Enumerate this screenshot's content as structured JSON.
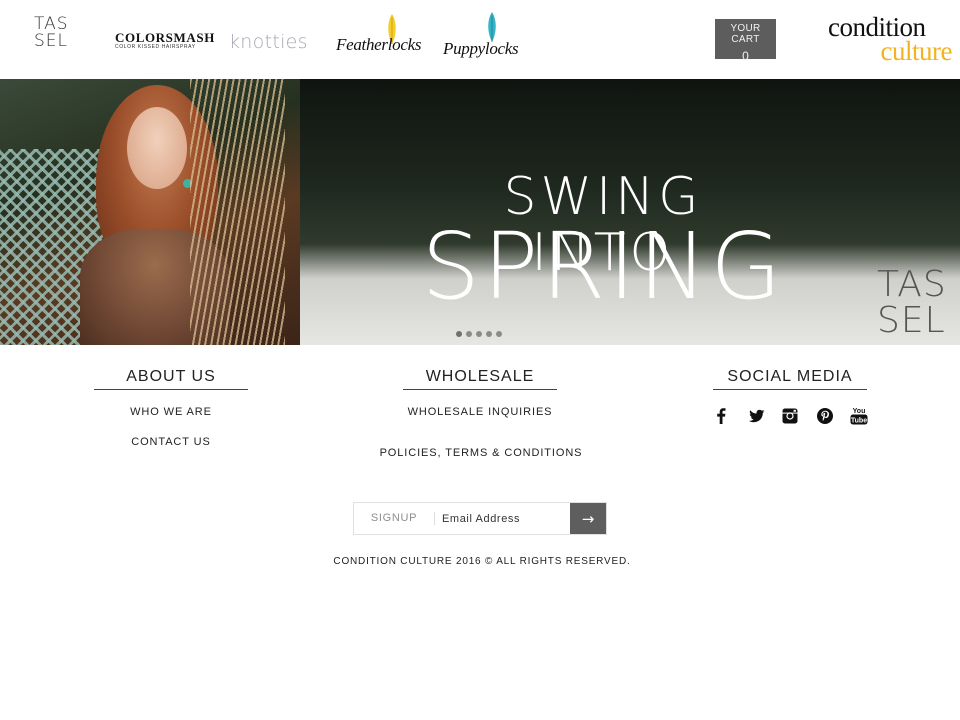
{
  "header": {
    "brands": {
      "tassel": [
        "TAS",
        "SEL"
      ],
      "colorsmash": {
        "name": "COLORSMASH",
        "tagline": "COLOR KISSED HAIRSPRAY"
      },
      "knotties": "knotties",
      "featherlocks": "Featherlocks",
      "puppylocks": "Puppylocks",
      "condition_culture": {
        "line1": "condition",
        "line2": "culture"
      }
    },
    "cart": {
      "label": "YOUR CART",
      "count": "0"
    }
  },
  "hero": {
    "headline_1": "SWING INTO",
    "headline_2": "SPRING",
    "corner_logo": [
      "TAS",
      "SEL"
    ],
    "slide_count": 5,
    "active_slide": 1
  },
  "footer": {
    "about": {
      "title": "ABOUT US",
      "links": [
        "WHO WE ARE",
        "CONTACT US"
      ]
    },
    "wholesale": {
      "title": "WHOLESALE",
      "links": [
        "WHOLESALE INQUIRIES",
        "POLICIES, TERMS & CONDITIONS"
      ]
    },
    "social": {
      "title": "SOCIAL MEDIA",
      "icons": [
        "facebook-icon",
        "twitter-icon",
        "instagram-icon",
        "pinterest-icon",
        "youtube-icon"
      ]
    },
    "signup": {
      "label": "SIGNUP",
      "placeholder": "Email Address",
      "submit_glyph": "→"
    },
    "copyright": "CONDITION CULTURE 2016 © ALL RIGHTS RESERVED."
  },
  "colors": {
    "accent_gold": "#f3b31d",
    "cart_bg": "#5d5d5d",
    "submit_bg": "#5e5e5e"
  }
}
